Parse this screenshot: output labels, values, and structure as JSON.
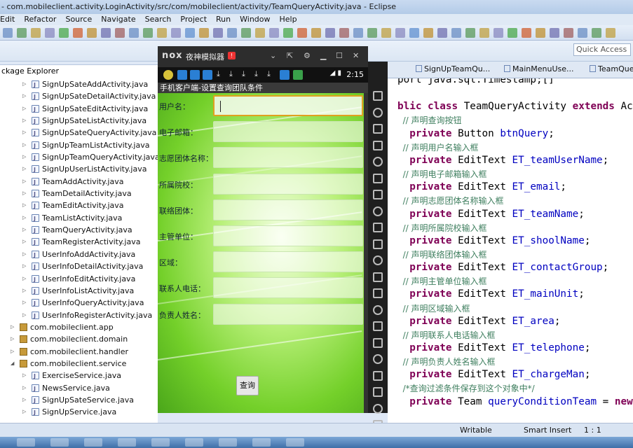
{
  "window": {
    "title": "- com.mobileclient.activity.LoginActivity/src/com/mobileclient/activity/TeamQueryActivity.java - Eclipse"
  },
  "menu": [
    "Edit",
    "Refactor",
    "Source",
    "Navigate",
    "Search",
    "Project",
    "Run",
    "Window",
    "Help"
  ],
  "quick_access": "Quick Access",
  "package_explorer": {
    "tab_label": "ckage Explorer",
    "items": [
      {
        "label": "SignUpSateAddActivity.java",
        "kind": "java",
        "indent": 2
      },
      {
        "label": "SignUpSateDetailActivity.java",
        "kind": "java",
        "indent": 2
      },
      {
        "label": "SignUpSateEditActivity.java",
        "kind": "java",
        "indent": 2
      },
      {
        "label": "SignUpSateListActivity.java",
        "kind": "java",
        "indent": 2
      },
      {
        "label": "SignUpSateQueryActivity.java",
        "kind": "java",
        "indent": 2
      },
      {
        "label": "SignUpTeamListActivity.java",
        "kind": "java",
        "indent": 2
      },
      {
        "label": "SignUpTeamQueryActivity.java",
        "kind": "java",
        "indent": 2
      },
      {
        "label": "SignUpUserListActivity.java",
        "kind": "java",
        "indent": 2
      },
      {
        "label": "TeamAddActivity.java",
        "kind": "java",
        "indent": 2
      },
      {
        "label": "TeamDetailActivity.java",
        "kind": "java",
        "indent": 2
      },
      {
        "label": "TeamEditActivity.java",
        "kind": "java",
        "indent": 2
      },
      {
        "label": "TeamListActivity.java",
        "kind": "java",
        "indent": 2
      },
      {
        "label": "TeamQueryActivity.java",
        "kind": "java",
        "indent": 2
      },
      {
        "label": "TeamRegisterActivity.java",
        "kind": "java",
        "indent": 2
      },
      {
        "label": "UserInfoAddActivity.java",
        "kind": "java",
        "indent": 2
      },
      {
        "label": "UserInfoDetailActivity.java",
        "kind": "java",
        "indent": 2
      },
      {
        "label": "UserInfoEditActivity.java",
        "kind": "java",
        "indent": 2
      },
      {
        "label": "UserInfoListActivity.java",
        "kind": "java",
        "indent": 2
      },
      {
        "label": "UserInfoQueryActivity.java",
        "kind": "java",
        "indent": 2
      },
      {
        "label": "UserInfoRegisterActivity.java",
        "kind": "java",
        "indent": 2
      },
      {
        "label": "com.mobileclient.app",
        "kind": "pkg",
        "indent": 1,
        "arrow": "▷"
      },
      {
        "label": "com.mobileclient.domain",
        "kind": "pkg",
        "indent": 1,
        "arrow": "▷"
      },
      {
        "label": "com.mobileclient.handler",
        "kind": "pkg",
        "indent": 1,
        "arrow": "▷"
      },
      {
        "label": "com.mobileclient.service",
        "kind": "pkg",
        "indent": 1,
        "arrow": "◢"
      },
      {
        "label": "ExerciseService.java",
        "kind": "java",
        "indent": 2
      },
      {
        "label": "NewsService.java",
        "kind": "java",
        "indent": 2
      },
      {
        "label": "SignUpSateService.java",
        "kind": "java",
        "indent": 2
      },
      {
        "label": "SignUpService.java",
        "kind": "java",
        "indent": 2
      }
    ]
  },
  "emulator": {
    "logo": "nox",
    "title": "夜神模拟器",
    "badge": "!",
    "time": "2:15",
    "app_title": "手机客户端-设置查询团队条件",
    "fields": [
      {
        "label": "用户名：",
        "focused": true
      },
      {
        "label": "电子邮箱：",
        "focused": false
      },
      {
        "label": "志愿团体名称：",
        "focused": false
      },
      {
        "label": "所属院校：",
        "focused": false
      },
      {
        "label": "联络团体：",
        "focused": false
      },
      {
        "label": "主管单位：",
        "focused": false
      },
      {
        "label": "区域：",
        "focused": false
      },
      {
        "label": "联系人电话：",
        "focused": false
      },
      {
        "label": "负责人姓名：",
        "focused": false
      }
    ],
    "query_button": "查询"
  },
  "editor": {
    "tabs": [
      "SignUpTeamQu...",
      "MainMenuUse...",
      "TeamQuer"
    ],
    "lines": [
      {
        "parts": [
          {
            "t": "port java.sql.Timestamp;[]",
            "c": ""
          }
        ]
      },
      {
        "parts": [
          {
            "t": "",
            "c": ""
          }
        ]
      },
      {
        "parts": [
          {
            "t": "blic ",
            "c": "kw"
          },
          {
            "t": "class ",
            "c": "kw"
          },
          {
            "t": "TeamQueryActivity ",
            "c": ""
          },
          {
            "t": "extends ",
            "c": "kw"
          },
          {
            "t": "Acti",
            "c": ""
          }
        ]
      },
      {
        "parts": [
          {
            "t": "  // 声明查询按钮",
            "c": "cmt"
          }
        ]
      },
      {
        "parts": [
          {
            "t": "  private ",
            "c": "kw"
          },
          {
            "t": "Button ",
            "c": ""
          },
          {
            "t": "btnQuery",
            "c": "fld"
          },
          {
            "t": ";",
            "c": ""
          }
        ]
      },
      {
        "parts": [
          {
            "t": "  // 声明用户名输入框",
            "c": "cmt"
          }
        ]
      },
      {
        "parts": [
          {
            "t": "  private ",
            "c": "kw"
          },
          {
            "t": "EditText ",
            "c": ""
          },
          {
            "t": "ET_teamUserName",
            "c": "fld"
          },
          {
            "t": ";",
            "c": ""
          }
        ]
      },
      {
        "parts": [
          {
            "t": "  // 声明电子邮箱输入框",
            "c": "cmt"
          }
        ]
      },
      {
        "parts": [
          {
            "t": "  private ",
            "c": "kw"
          },
          {
            "t": "EditText ",
            "c": ""
          },
          {
            "t": "ET_email",
            "c": "fld"
          },
          {
            "t": ";",
            "c": ""
          }
        ]
      },
      {
        "parts": [
          {
            "t": "  // 声明志愿团体名称输入框",
            "c": "cmt"
          }
        ]
      },
      {
        "parts": [
          {
            "t": "  private ",
            "c": "kw"
          },
          {
            "t": "EditText ",
            "c": ""
          },
          {
            "t": "ET_teamName",
            "c": "fld"
          },
          {
            "t": ";",
            "c": ""
          }
        ]
      },
      {
        "parts": [
          {
            "t": "  // 声明所属院校输入框",
            "c": "cmt"
          }
        ]
      },
      {
        "parts": [
          {
            "t": "  private ",
            "c": "kw"
          },
          {
            "t": "EditText ",
            "c": ""
          },
          {
            "t": "ET_shoolName",
            "c": "fld"
          },
          {
            "t": ";",
            "c": ""
          }
        ]
      },
      {
        "parts": [
          {
            "t": "  // 声明联络团体输入框",
            "c": "cmt"
          }
        ]
      },
      {
        "parts": [
          {
            "t": "  private ",
            "c": "kw"
          },
          {
            "t": "EditText ",
            "c": ""
          },
          {
            "t": "ET_contactGroup",
            "c": "fld"
          },
          {
            "t": ";",
            "c": ""
          }
        ]
      },
      {
        "parts": [
          {
            "t": "  // 声明主管单位输入框",
            "c": "cmt"
          }
        ]
      },
      {
        "parts": [
          {
            "t": "  private ",
            "c": "kw"
          },
          {
            "t": "EditText ",
            "c": ""
          },
          {
            "t": "ET_mainUnit",
            "c": "fld"
          },
          {
            "t": ";",
            "c": ""
          }
        ]
      },
      {
        "parts": [
          {
            "t": "  // 声明区域输入框",
            "c": "cmt"
          }
        ]
      },
      {
        "parts": [
          {
            "t": "  private ",
            "c": "kw"
          },
          {
            "t": "EditText ",
            "c": ""
          },
          {
            "t": "ET_area",
            "c": "fld"
          },
          {
            "t": ";",
            "c": ""
          }
        ]
      },
      {
        "parts": [
          {
            "t": "  // 声明联系人电话输入框",
            "c": "cmt"
          }
        ]
      },
      {
        "parts": [
          {
            "t": "  private ",
            "c": "kw"
          },
          {
            "t": "EditText ",
            "c": ""
          },
          {
            "t": "ET_telephone",
            "c": "fld"
          },
          {
            "t": ";",
            "c": ""
          }
        ]
      },
      {
        "parts": [
          {
            "t": "  // 声明负责人姓名输入框",
            "c": "cmt"
          }
        ]
      },
      {
        "parts": [
          {
            "t": "  private ",
            "c": "kw"
          },
          {
            "t": "EditText ",
            "c": ""
          },
          {
            "t": "ET_chargeMan",
            "c": "fld"
          },
          {
            "t": ";",
            "c": ""
          }
        ]
      },
      {
        "parts": [
          {
            "t": "  /*查询过滤条件保存到这个对象中*/",
            "c": "cmt"
          }
        ]
      },
      {
        "parts": [
          {
            "t": "  private ",
            "c": "kw"
          },
          {
            "t": "Team ",
            "c": ""
          },
          {
            "t": "queryConditionTeam ",
            "c": "fld"
          },
          {
            "t": "= ",
            "c": ""
          },
          {
            "t": "new ",
            "c": "kw"
          },
          {
            "t": "T",
            "c": ""
          }
        ]
      }
    ]
  },
  "status": {
    "writable": "Writable",
    "insert_mode": "Smart Insert",
    "position": "1 : 1"
  },
  "colors": {
    "eclipse_bg": "#dfe8f6",
    "emulator_frame": "#222222",
    "app_green": "#74d02a",
    "keyword": "#7f0055",
    "field": "#0000c0",
    "comment": "#3f7f5f"
  }
}
